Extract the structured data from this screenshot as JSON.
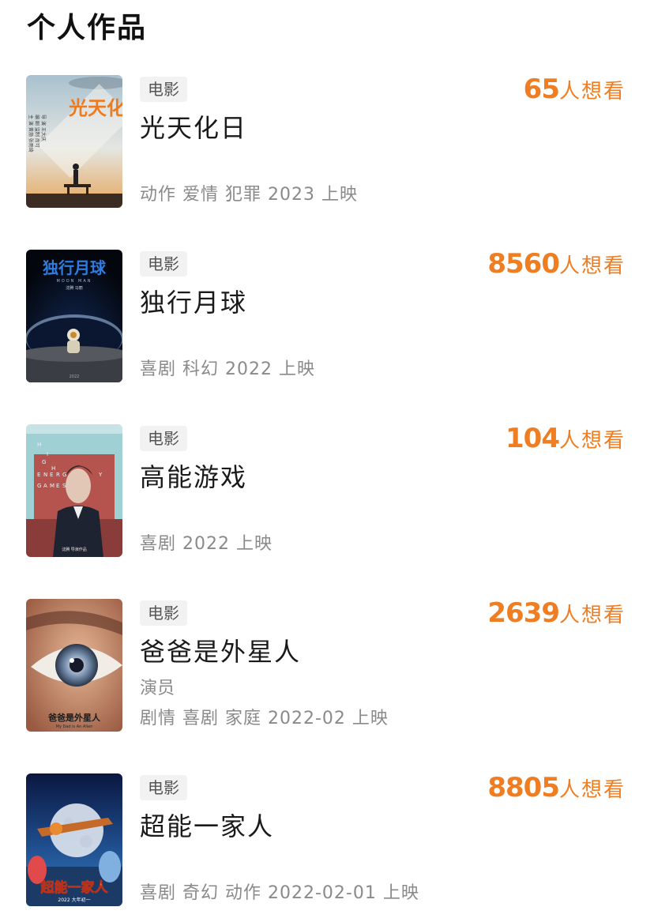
{
  "section": {
    "title": "个人作品"
  },
  "works": [
    {
      "category": "电影",
      "title": "光天化日",
      "role": "",
      "meta": "动作 爱情 犯罪 2023 上映",
      "want_count": "65",
      "want_label": "人想看",
      "poster": {
        "title_text": "光天化日",
        "credits": [
          "导 演  王大庆",
          "编 剧 监制  尚可",
          "主 演  黄渤  张雨绮"
        ],
        "bg_top": "#bcd0dc",
        "bg_bottom": "#e9b876",
        "title_color": "#f07a1a"
      }
    },
    {
      "category": "电影",
      "title": "独行月球",
      "role": "",
      "meta": "喜剧 科幻 2022 上映",
      "want_count": "8560",
      "want_label": "人想看",
      "poster": {
        "title_text": "独行月球",
        "subtitle": "MOON MAN",
        "credits": [
          "沈腾 马丽"
        ],
        "year": "2022",
        "bg_top": "#050a14",
        "bg_bottom": "#2a2f3a",
        "title_color": "#2f7ce0"
      }
    },
    {
      "category": "电影",
      "title": "高能游戏",
      "role": "",
      "meta": "喜剧 2022 上映",
      "want_count": "104",
      "want_label": "人想看",
      "poster": {
        "letters": [
          "H",
          "I",
          "G",
          "H",
          "E",
          "N",
          "E",
          "R",
          "G",
          "Y",
          "G",
          "A",
          "M",
          "E",
          "S"
        ],
        "credits": [
          "沈腾 导演作品"
        ],
        "bg_top": "#a8d4d8",
        "bg_bottom": "#b85a56",
        "title_color": "#e8f3f4"
      }
    },
    {
      "category": "电影",
      "title": "爸爸是外星人",
      "role": "演员",
      "meta": "剧情 喜剧 家庭 2022-02 上映",
      "want_count": "2639",
      "want_label": "人想看",
      "poster": {
        "title_text": "爸爸是外星人",
        "subtitle": "My Dad is An Alien",
        "bg_top": "#b7775c",
        "bg_bottom": "#d49d7a",
        "title_color": "#1b1b1b"
      }
    },
    {
      "category": "电影",
      "title": "超能一家人",
      "role": "",
      "meta": "喜剧 奇幻 动作 2022-02-01 上映",
      "want_count": "8805",
      "want_label": "人想看",
      "poster": {
        "title_text": "超能一家人",
        "date_text": "2022 大年初一",
        "bg_top": "#0d1d4a",
        "bg_bottom": "#2a6fb0",
        "title_color": "#ffcc1f"
      }
    }
  ]
}
